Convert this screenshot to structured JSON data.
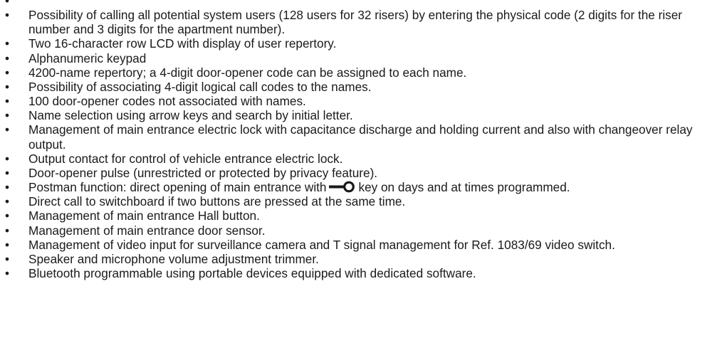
{
  "features": [
    {
      "text": ""
    },
    {
      "text": "Possibility of calling all potential system users  (128 users for 32 risers) by entering the physical code (2 digits for the riser number and 3 digits for the apartment number)."
    },
    {
      "text": "Two 16-character row LCD with display of user repertory."
    },
    {
      "text": "Alphanumeric keypad"
    },
    {
      "text": "4200-name repertory; a 4-digit door-opener code can be assigned to each name."
    },
    {
      "text": "Possibility of associating 4-digit logical call codes to the names."
    },
    {
      "text": "100 door-opener codes not associated with names."
    },
    {
      "text": "Name selection using arrow keys and search by initial letter."
    },
    {
      "text": "Management of main entrance electric lock with capacitance discharge and holding current and also with changeover relay output."
    },
    {
      "text": "Output contact for control of vehicle entrance electric lock."
    },
    {
      "text": "Door-opener pulse (unrestricted or protected by privacy feature)."
    },
    {
      "text_before": "Postman function: direct opening of main entrance with",
      "icon": "key-icon",
      "text_after": "key on days and at times programmed."
    },
    {
      "text": "Direct call to switchboard if two buttons are pressed at the same time."
    },
    {
      "text": "Management of main entrance Hall button."
    },
    {
      "text": "Management of main entrance door sensor."
    },
    {
      "text": "Management of video input for surveillance camera and T signal management for Ref. 1083/69 video switch."
    },
    {
      "text": "Speaker and microphone volume adjustment trimmer."
    },
    {
      "text": "Bluetooth programmable using portable devices equipped with dedicated software."
    }
  ],
  "bullet_char": "•",
  "colors": {
    "text": "#1a1a1a",
    "background": "#ffffff"
  }
}
